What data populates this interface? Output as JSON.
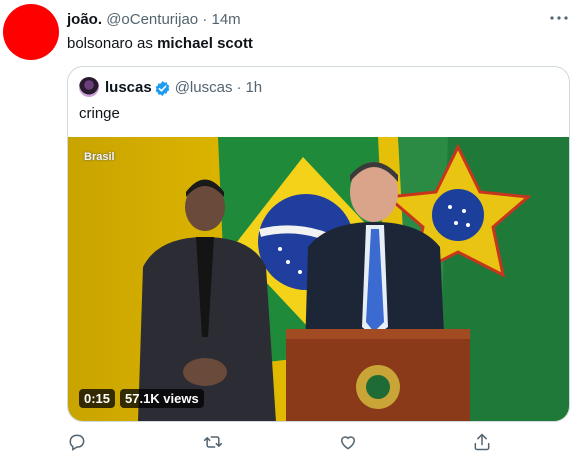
{
  "author": {
    "name": "joão.",
    "handle": "@oCenturijao",
    "time": "14m"
  },
  "tweet": {
    "text_plain": "bolsonaro as ",
    "text_bold": "michael scott"
  },
  "quoted": {
    "name": "luscas",
    "handle": "@luscas",
    "time": "1h",
    "text": "cringe",
    "video": {
      "duration": "0:15",
      "views": "57.1K views",
      "channel_logo": "Brasil"
    }
  },
  "icons": [
    "more-icon",
    "verified-icon",
    "reply-icon",
    "retweet-icon",
    "like-icon",
    "share-icon"
  ],
  "colors": {
    "avatar": "#ff0000",
    "muted": "#536471",
    "verified": "#1d9bf0",
    "border": "#cfd9de"
  }
}
